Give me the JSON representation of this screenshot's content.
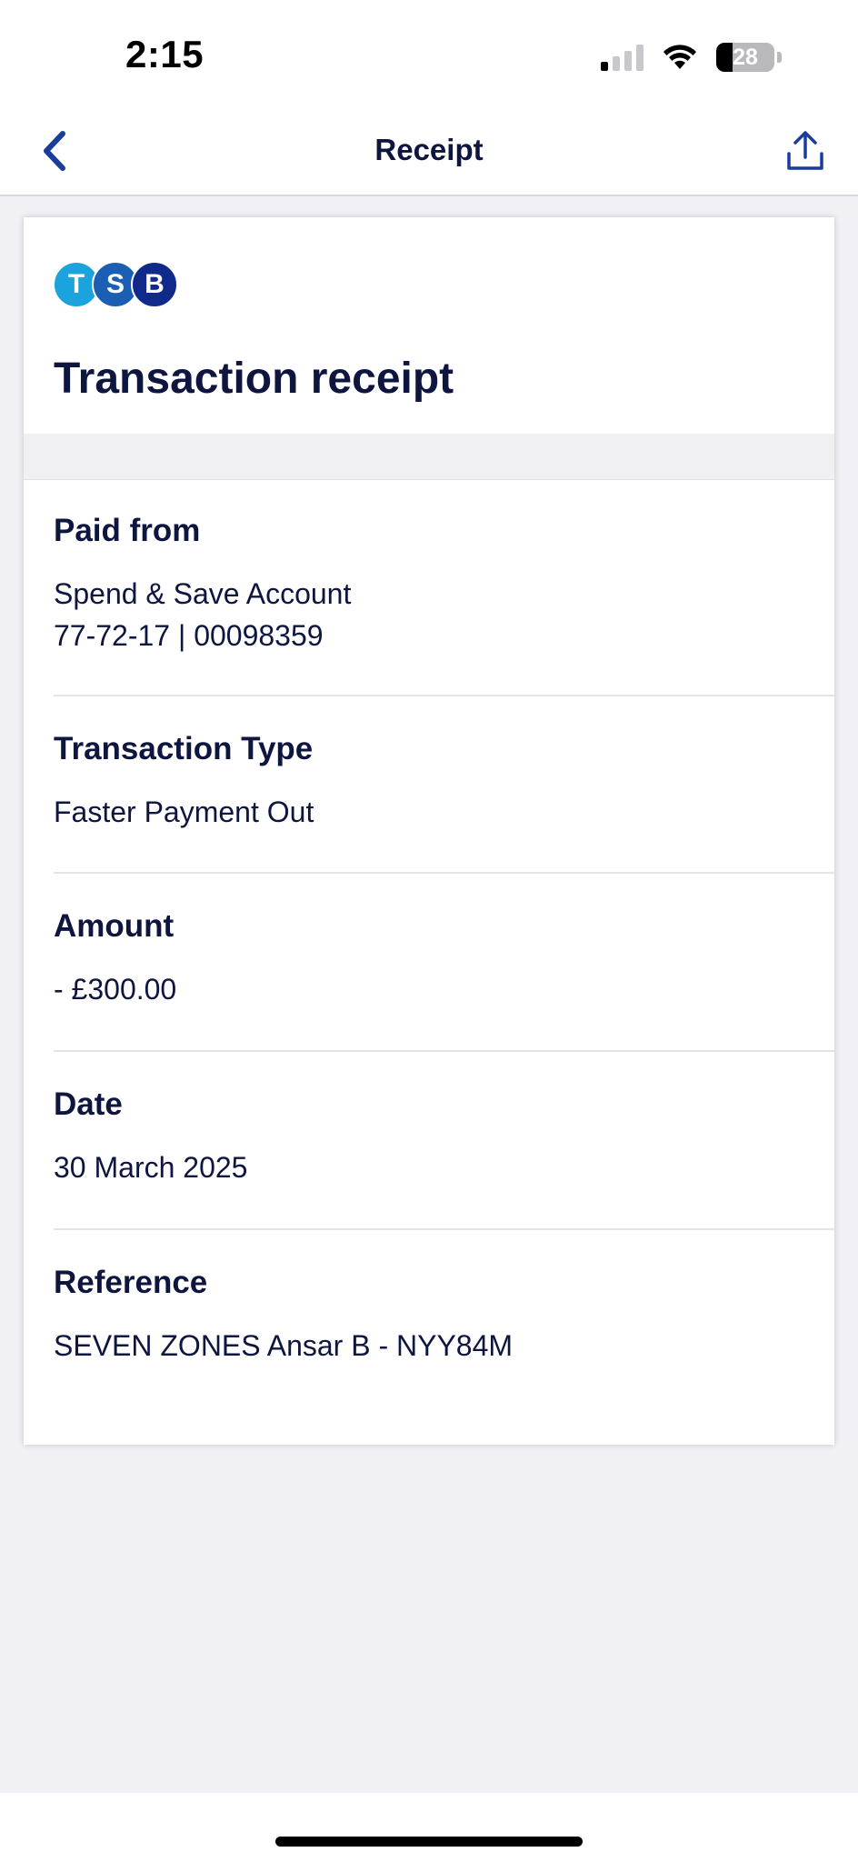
{
  "status_bar": {
    "time": "2:15",
    "battery_level": "28",
    "battery_fraction": 0.28,
    "signal_bars_active": 1,
    "signal_bars_total": 4
  },
  "nav": {
    "title": "Receipt",
    "back_icon": "chevron-left-icon",
    "share_icon": "share-icon",
    "accent_color": "#1a3d9c"
  },
  "logo": {
    "letters": [
      "T",
      "S",
      "B"
    ],
    "colors": [
      "#1aa3dc",
      "#1a5fb4",
      "#0f2a8a"
    ]
  },
  "receipt": {
    "title": "Transaction receipt",
    "paid_from": {
      "label": "Paid from",
      "account_name": "Spend & Save Account",
      "account_number": "77-72-17 | 00098359"
    },
    "transaction_type": {
      "label": "Transaction Type",
      "value": "Faster Payment Out"
    },
    "amount": {
      "label": "Amount",
      "value": "- £300.00"
    },
    "date": {
      "label": "Date",
      "value": "30 March 2025"
    },
    "reference": {
      "label": "Reference",
      "value": "SEVEN ZONES Ansar B - NYY84M"
    }
  }
}
